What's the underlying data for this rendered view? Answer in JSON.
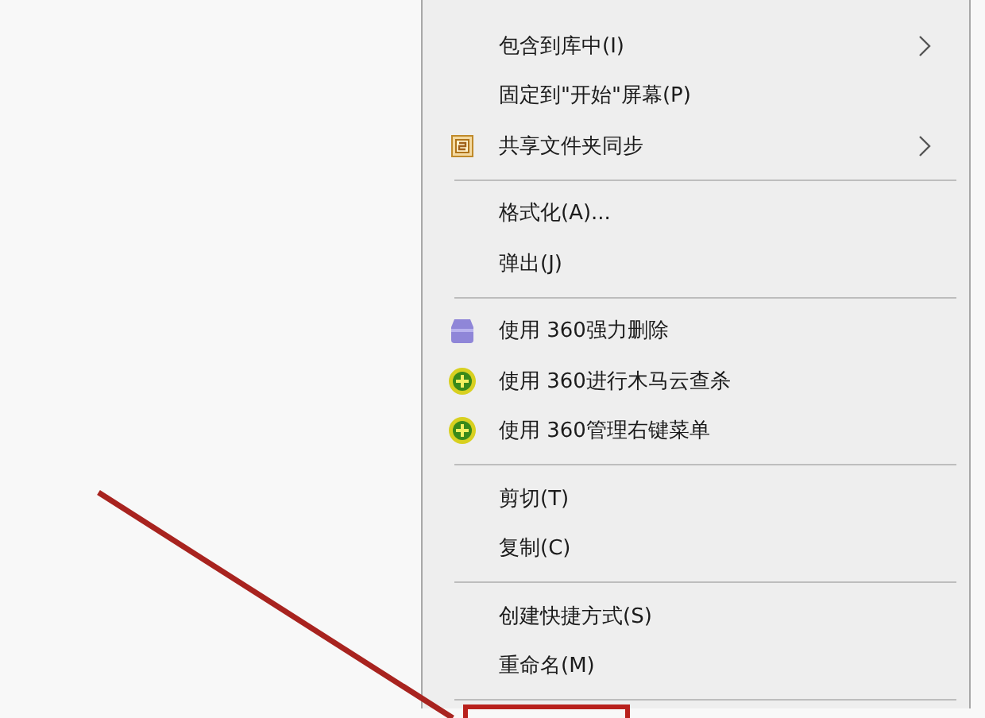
{
  "context_menu": {
    "items": [
      {
        "kind": "plain",
        "label": "包含到库中(I)",
        "has_submenu": true
      },
      {
        "kind": "plain",
        "label": "固定到\"开始\"屏幕(P)",
        "has_submenu": false
      },
      {
        "kind": "sync",
        "label": "共享文件夹同步",
        "has_submenu": true
      },
      {
        "kind": "separator"
      },
      {
        "kind": "plain",
        "label": "格式化(A)...",
        "has_submenu": false
      },
      {
        "kind": "plain",
        "label": "弹出(J)",
        "has_submenu": false
      },
      {
        "kind": "separator"
      },
      {
        "kind": "shred",
        "label": "使用 360强力删除",
        "has_submenu": false
      },
      {
        "kind": "guard",
        "label": "使用 360进行木马云查杀",
        "has_submenu": false
      },
      {
        "kind": "guard",
        "label": "使用 360管理右键菜单",
        "has_submenu": false
      },
      {
        "kind": "separator"
      },
      {
        "kind": "plain",
        "label": "剪切(T)",
        "has_submenu": false
      },
      {
        "kind": "plain",
        "label": "复制(C)",
        "has_submenu": false
      },
      {
        "kind": "separator"
      },
      {
        "kind": "plain",
        "label": "创建快捷方式(S)",
        "has_submenu": false
      },
      {
        "kind": "plain",
        "label": "重命名(M)",
        "has_submenu": false
      },
      {
        "kind": "separator"
      }
    ]
  },
  "annotation": {
    "kind": "arrow_to_box"
  }
}
